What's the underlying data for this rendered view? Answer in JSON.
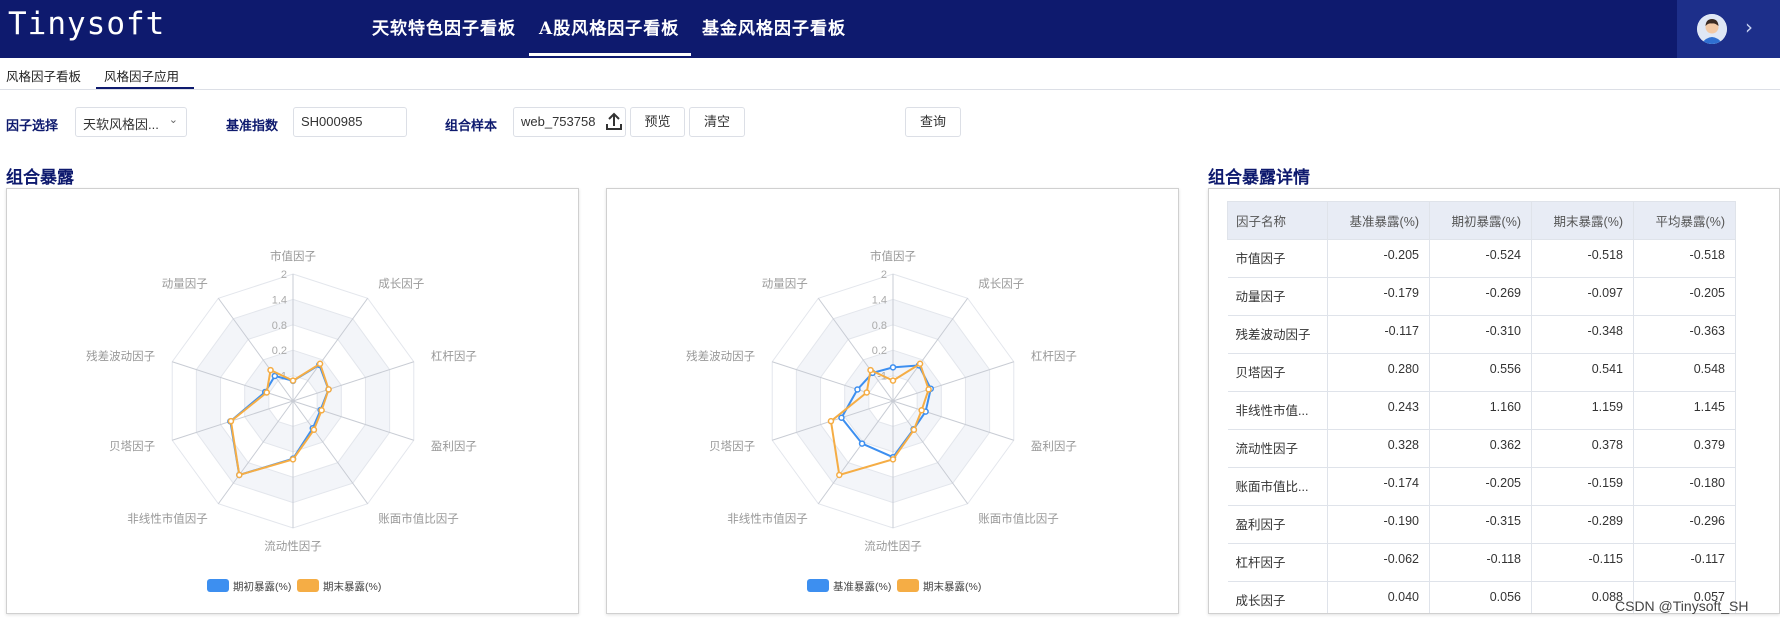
{
  "app": {
    "logo": "Tinysoft"
  },
  "nav": {
    "tabs": [
      {
        "label": "天软特色因子看板",
        "active": false
      },
      {
        "label": "A股风格因子看板",
        "active": true
      },
      {
        "label": "基金风格因子看板",
        "active": false
      }
    ]
  },
  "user": {
    "avatar_icon": "user-avatar-icon",
    "expand_icon": "chevron-right-icon"
  },
  "subtabs": [
    {
      "label": "风格因子看板",
      "active": false
    },
    {
      "label": "风格因子应用",
      "active": true
    }
  ],
  "form": {
    "factor_label": "因子选择",
    "factor_value": "天软风格因...",
    "benchmark_label": "基准指数",
    "benchmark_value": "SH000985",
    "portfolio_label": "组合样本",
    "portfolio_value": "web_753758",
    "preview_button": "预览",
    "clear_button": "清空",
    "query_button": "查询"
  },
  "sections": {
    "exposure_title": "组合暴露",
    "detail_title": "组合暴露详情"
  },
  "colors": {
    "blue": "#3d8ff0",
    "orange": "#f5ad45",
    "navy": "#0e1a6e"
  },
  "chart_data": [
    {
      "type": "radar",
      "indicators": [
        "市值因子",
        "成长因子",
        "杠杆因子",
        "盈利因子",
        "账面市值比因子",
        "流动性因子",
        "非线性市值因子",
        "贝塔因子",
        "残差波动因子",
        "动量因子"
      ],
      "ticks": [
        "2",
        "1.4",
        "0.8",
        "0.2",
        "-1"
      ],
      "range": [
        -1,
        2
      ],
      "series": [
        {
          "name": "期初暴露(%)",
          "color": "#3d8ff0",
          "values": [
            -0.524,
            0.056,
            -0.118,
            -0.315,
            -0.205,
            0.362,
            1.16,
            0.556,
            -0.31,
            -0.269
          ]
        },
        {
          "name": "期末暴露(%)",
          "color": "#f5ad45",
          "values": [
            -0.518,
            0.088,
            -0.115,
            -0.289,
            -0.159,
            0.378,
            1.159,
            0.541,
            -0.348,
            -0.097
          ]
        }
      ]
    },
    {
      "type": "radar",
      "indicators": [
        "市值因子",
        "成长因子",
        "杠杆因子",
        "盈利因子",
        "账面市值比因子",
        "流动性因子",
        "非线性市值因子",
        "贝塔因子",
        "残差波动因子",
        "动量因子"
      ],
      "ticks": [
        "2",
        "1.4",
        "0.8",
        "0.2",
        "-1"
      ],
      "range": [
        -1,
        2
      ],
      "series": [
        {
          "name": "基准暴露(%)",
          "color": "#3d8ff0",
          "values": [
            -0.205,
            0.04,
            -0.062,
            -0.19,
            -0.174,
            0.328,
            0.243,
            0.28,
            -0.117,
            -0.179
          ]
        },
        {
          "name": "期末暴露(%)",
          "color": "#f5ad45",
          "values": [
            -0.518,
            0.088,
            -0.115,
            -0.289,
            -0.159,
            0.378,
            1.159,
            0.541,
            -0.348,
            -0.097
          ]
        }
      ]
    }
  ],
  "table": {
    "headers": [
      "因子名称",
      "基准暴露(%)",
      "期初暴露(%)",
      "期末暴露(%)",
      "平均暴露(%)"
    ],
    "rows": [
      [
        "市值因子",
        "-0.205",
        "-0.524",
        "-0.518",
        "-0.518"
      ],
      [
        "动量因子",
        "-0.179",
        "-0.269",
        "-0.097",
        "-0.205"
      ],
      [
        "残差波动因子",
        "-0.117",
        "-0.310",
        "-0.348",
        "-0.363"
      ],
      [
        "贝塔因子",
        "0.280",
        "0.556",
        "0.541",
        "0.548"
      ],
      [
        "非线性市值...",
        "0.243",
        "1.160",
        "1.159",
        "1.145"
      ],
      [
        "流动性因子",
        "0.328",
        "0.362",
        "0.378",
        "0.379"
      ],
      [
        "账面市值比...",
        "-0.174",
        "-0.205",
        "-0.159",
        "-0.180"
      ],
      [
        "盈利因子",
        "-0.190",
        "-0.315",
        "-0.289",
        "-0.296"
      ],
      [
        "杠杆因子",
        "-0.062",
        "-0.118",
        "-0.115",
        "-0.117"
      ],
      [
        "成长因子",
        "0.040",
        "0.056",
        "0.088",
        "0.057"
      ]
    ]
  },
  "watermark": "CSDN @Tinysoft_SH"
}
